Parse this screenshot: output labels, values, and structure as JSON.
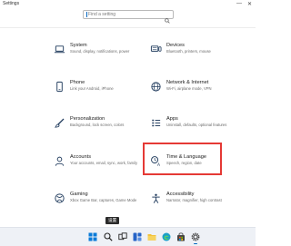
{
  "window": {
    "title": "Settings",
    "controls": {
      "minimize": "—",
      "close": "✕"
    }
  },
  "search": {
    "placeholder": "Find a setting"
  },
  "categories": [
    {
      "name": "System",
      "description": "Sound, display, notifications, power",
      "icon": "laptop-icon"
    },
    {
      "name": "Devices",
      "description": "Bluetooth, printers, mouse",
      "icon": "keyboard-icon"
    },
    {
      "name": "Phone",
      "description": "Link your Android, iPhone",
      "icon": "phone-icon"
    },
    {
      "name": "Network & Internet",
      "description": "Wi-Fi, airplane mode, VPN",
      "icon": "globe-icon"
    },
    {
      "name": "Personalization",
      "description": "Background, lock screen, colors",
      "icon": "brush-icon"
    },
    {
      "name": "Apps",
      "description": "Uninstall, defaults, optional features",
      "icon": "apps-icon"
    },
    {
      "name": "Accounts",
      "description": "Your accounts, email, sync, work, family",
      "icon": "person-icon"
    },
    {
      "name": "Time & Language",
      "description": "Speech, region, date",
      "icon": "clock-language-icon"
    },
    {
      "name": "Gaming",
      "description": "Xbox Game Bar, captures, Game Mode",
      "icon": "xbox-icon"
    },
    {
      "name": "Accessibility",
      "description": "Narrator, magnifier, high contrast",
      "icon": "accessibility-icon"
    }
  ],
  "highlighted_category": "Time & Language",
  "highlight_color": "#e53935",
  "accent_color": "#0067c0",
  "tooltip": {
    "label": "设置"
  },
  "taskbar": {
    "items": [
      "start-icon",
      "search-icon",
      "task-view-icon",
      "widgets-icon",
      "file-explorer-icon",
      "edge-icon",
      "store-icon",
      "settings-icon"
    ],
    "active": "settings-icon"
  }
}
